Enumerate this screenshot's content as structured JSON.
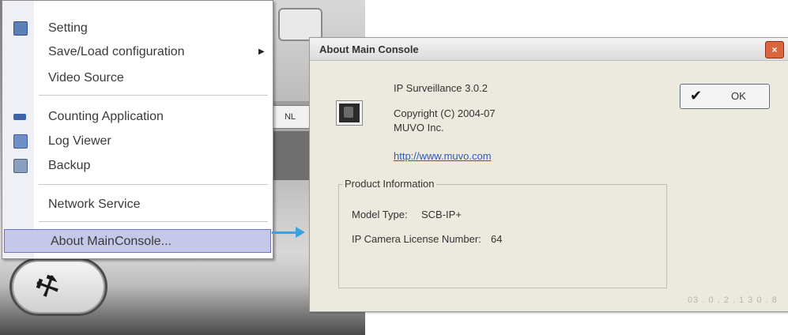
{
  "menu": {
    "items": [
      {
        "label": "Setting",
        "icon": "setting-icon"
      },
      {
        "label": "Save/Load configuration",
        "has_submenu": true
      },
      {
        "label": "Video Source"
      },
      {
        "label": "Counting Application",
        "icon": "counting-icon"
      },
      {
        "label": "Log Viewer",
        "icon": "log-viewer-icon"
      },
      {
        "label": "Backup",
        "icon": "backup-icon"
      },
      {
        "label": "Network Service"
      },
      {
        "label": "About MainConsole...",
        "highlighted": true
      }
    ]
  },
  "background_app": {
    "small_button_label": "NL"
  },
  "dialog": {
    "title": "About Main Console",
    "close_glyph": "×",
    "product": "IP Surveillance 3.0.2",
    "copyright": "Copyright (C) 2004-07",
    "company": "MUVO Inc.",
    "link": "http://www.muvo.com",
    "ok_label": "OK",
    "group_title": "Product Information",
    "model_type_label": "Model Type:",
    "model_type_value": "SCB-IP+",
    "license_label": "IP Camera License Number:",
    "license_value": "64",
    "version_footer": "03 . 0 . 2 . 1 3 0 . 8"
  },
  "colors": {
    "menu_highlight": "#c5c8e8",
    "arrow": "#3aa0e0",
    "dialog_bg": "#ece9df"
  }
}
